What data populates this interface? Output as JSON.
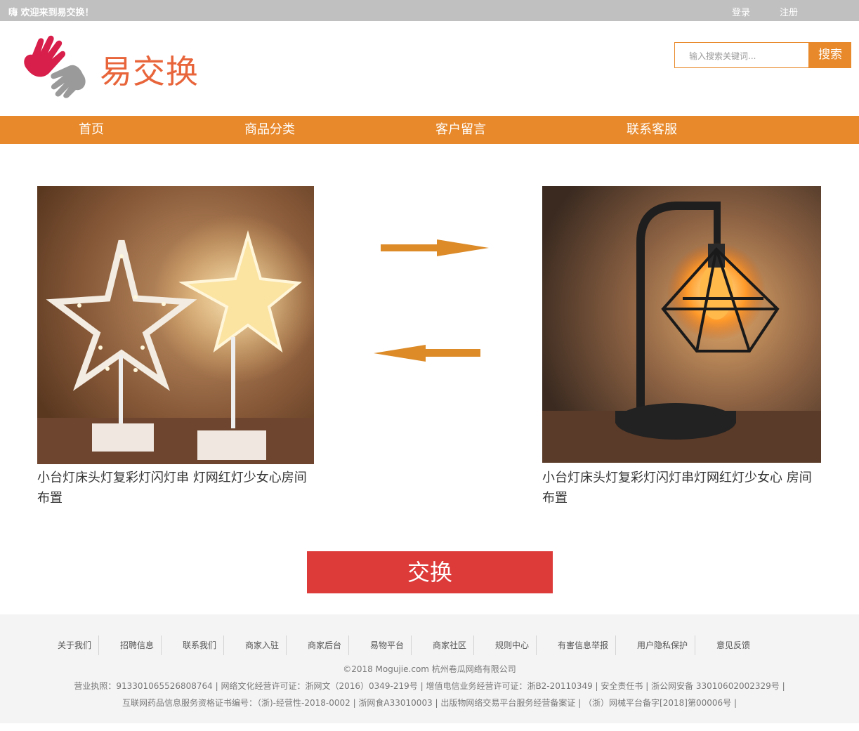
{
  "topbar": {
    "welcome": "嗨 欢迎来到易交换！",
    "login": "登录",
    "register": "注册"
  },
  "header": {
    "logo_text": "易交换",
    "search_placeholder": "输入搜索关键词...",
    "search_button": "搜索"
  },
  "nav": [
    "首页",
    "商品分类",
    "客户留言",
    "联系客服"
  ],
  "products": {
    "left_title": "小台灯床头灯复彩灯闪灯串 灯网红灯少女心房间布置",
    "right_title": "小台灯床头灯复彩灯闪灯串灯网红灯少女心 房间布置"
  },
  "exchange_button": "交换",
  "footer": {
    "links": [
      "关于我们",
      "招聘信息",
      "联系我们",
      "商家入驻",
      "商家后台",
      "易物平台",
      "商家社区",
      "规则中心",
      "有害信息举报",
      "用户隐私保护",
      "意见反馈"
    ],
    "copyright": "©2018 Mogujie.com 杭州卷瓜网络有限公司",
    "license1": "营业执照：91330106552680876​4 | 网络文化经营许可证：浙网文（2016）0349-219号 | 增值电信业务经营许可证：浙B2-20110349 | 安全责任书 | 浙公网安备 33010602002329号 |",
    "license2": "互联网药品信息服务资格证书编号：（浙)-经营性-2018-0002 | 浙网食A33010003 | 出版物网络交易平台服务经营备案证 | （浙）网械平台备字[2018]第00006号 |"
  },
  "colors": {
    "accent": "#e8892b",
    "topbar": "#c0c0c0",
    "exchange": "#dd3a3a",
    "logo": "#e8643a"
  }
}
